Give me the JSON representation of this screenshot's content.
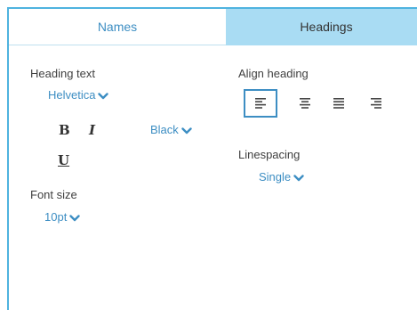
{
  "tabs": [
    {
      "label": "Names",
      "active": false
    },
    {
      "label": "Headings",
      "active": true
    }
  ],
  "heading_text": {
    "label": "Heading text",
    "font": "Helvetica",
    "bold_label": "B",
    "italic_label": "I",
    "underline_label": "U",
    "color": "Black"
  },
  "font_size": {
    "label": "Font size",
    "value": "10pt"
  },
  "align_heading": {
    "label": "Align heading",
    "options": [
      "align-left-icon",
      "align-center-icon",
      "align-justify-icon",
      "align-right-icon"
    ],
    "selected": "align-left-icon"
  },
  "linespacing": {
    "label": "Linespacing",
    "value": "Single"
  },
  "colors": {
    "accent": "#3d8ec3",
    "frame_border": "#4fb3df",
    "active_tab_bg": "#a9dcf3"
  }
}
